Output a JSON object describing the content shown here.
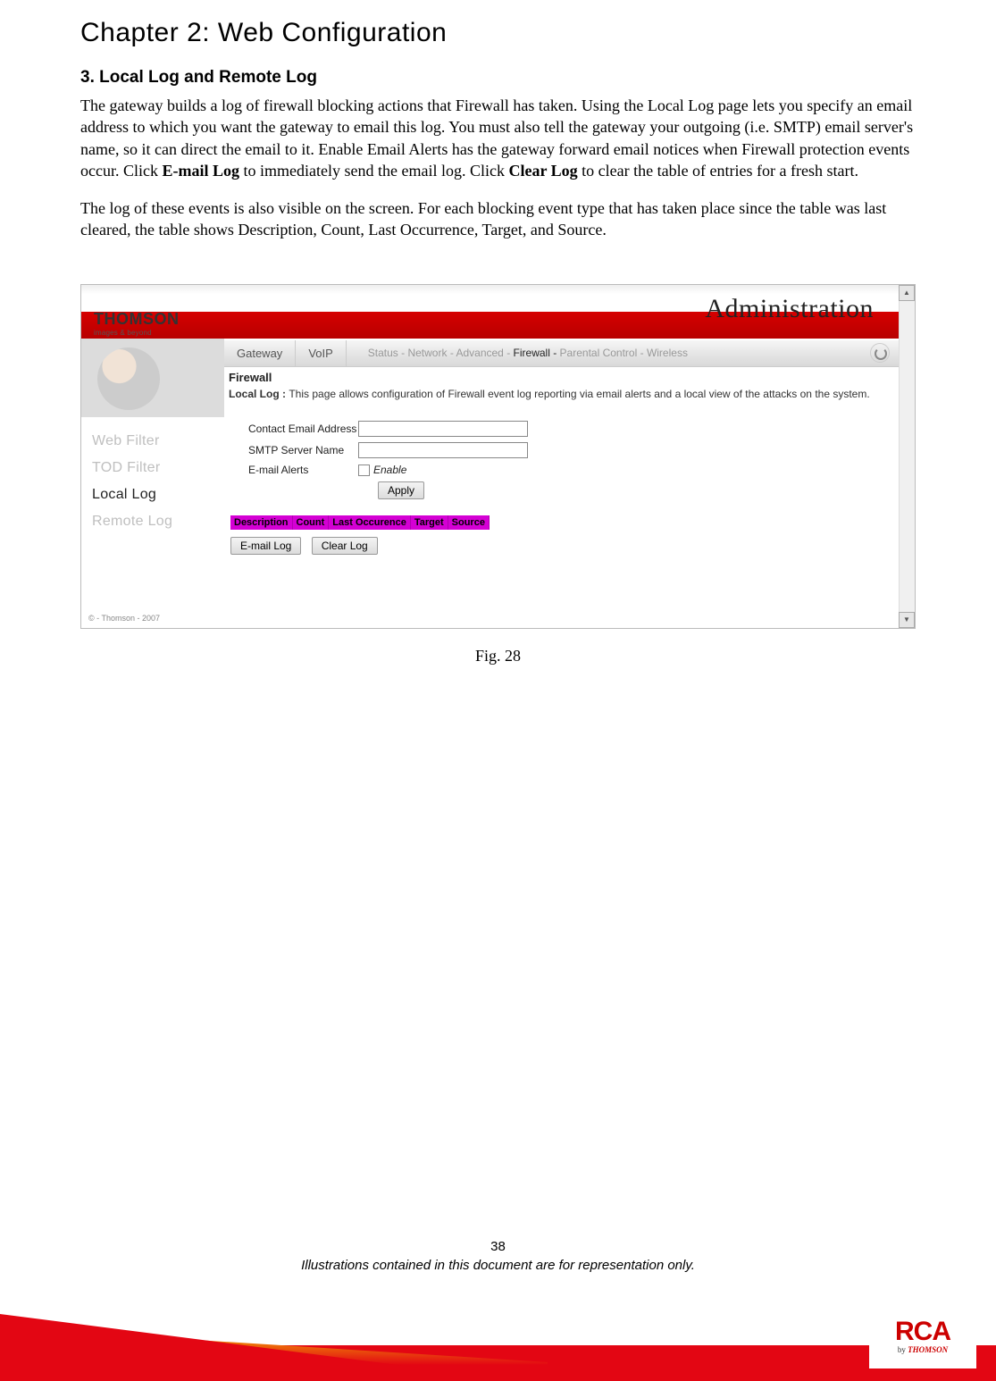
{
  "chapter_title": "Chapter 2: Web Configuration",
  "section_title": "3. Local Log and Remote Log",
  "para1_a": "The gateway builds a log of firewall blocking actions that Firewall has taken.    Using the Local Log page lets you specify an email address to which you want the gateway to email this log. You must also tell the gateway your outgoing (i.e. SMTP) email server's name, so it can direct the email to it. Enable Email Alerts has the gateway forward email notices when Firewall protection events occur. Click ",
  "para1_b1": "E-mail Log",
  "para1_c": " to immediately send the email log. Click ",
  "para1_b2": "Clear Log",
  "para1_d": " to clear the table of entries for a fresh start.",
  "para2": "The log of these events is also visible on the screen. For each blocking event type that has taken place since the table was last cleared, the table shows Description, Count, Last Occurrence, Target, and Source.",
  "fig_caption": "Fig. 28",
  "page_number": "38",
  "tagline": "Illustrations contained in this document are for representation only.",
  "screenshot": {
    "brand_main": "THOMSON",
    "brand_sub": "images & beyond",
    "admin_title": "Administration",
    "tabs": {
      "gateway": "Gateway",
      "voip": "VoIP"
    },
    "subnav": {
      "status": "Status - ",
      "network": "Network - ",
      "advanced": "Advanced - ",
      "firewall": "Firewall - ",
      "parental": "Parental Control - ",
      "wireless": "Wireless"
    },
    "sidebar": {
      "items": [
        "Web Filter",
        "TOD Filter",
        "Local Log",
        "Remote Log"
      ],
      "copyright": "© - Thomson - 2007"
    },
    "panel": {
      "title": "Firewall",
      "desc_lead": "Local Log  : ",
      "desc_rest": "This page allows configuration of Firewall event log reporting via email alerts and a local view of the attacks on the system.",
      "contact_label": "Contact Email Address",
      "smtp_label": "SMTP Server Name",
      "alerts_label": "E-mail Alerts",
      "enable_label": "Enable",
      "apply_btn": "Apply",
      "email_log_btn": "E-mail Log",
      "clear_log_btn": "Clear Log",
      "table_headers": [
        "Description",
        "Count",
        "Last Occurence",
        "Target",
        "Source"
      ]
    }
  },
  "footer_logo": {
    "rca": "RCA",
    "by_prefix": "by ",
    "by_brand": "THOMSON"
  }
}
